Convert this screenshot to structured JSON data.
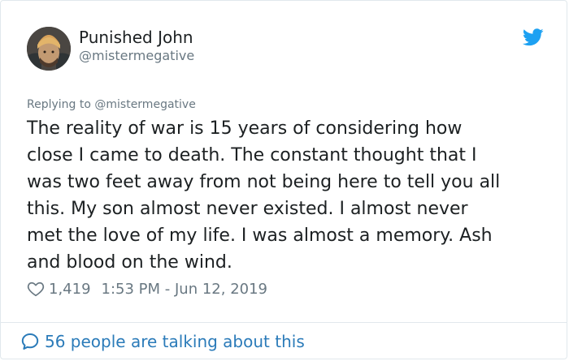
{
  "tweet": {
    "author_name": "Punished John",
    "author_handle": "@mistermegative",
    "replying_to": "Replying to @mistermegative",
    "text": "The reality of war is 15 years of considering how\nclose I came to death. The constant thought that I\nwas two feet away from not being here to tell you all\nthis. My son almost never existed. I almost never\nmet the love of my life. I was almost a memory. Ash\nand blood on the wind.",
    "likes": "1,419",
    "timestamp": "1:53 PM - Jun 12, 2019",
    "talking": "56 people are talking about this"
  },
  "colors": {
    "text": "#1c2022",
    "muted": "#697882",
    "link": "#2b7bb9",
    "twitter_blue": "#1da1f2",
    "border": "#e1e8ed"
  },
  "icons": {
    "brand": "twitter-bird-icon",
    "like": "heart-icon",
    "reply": "speech-bubble-icon"
  }
}
